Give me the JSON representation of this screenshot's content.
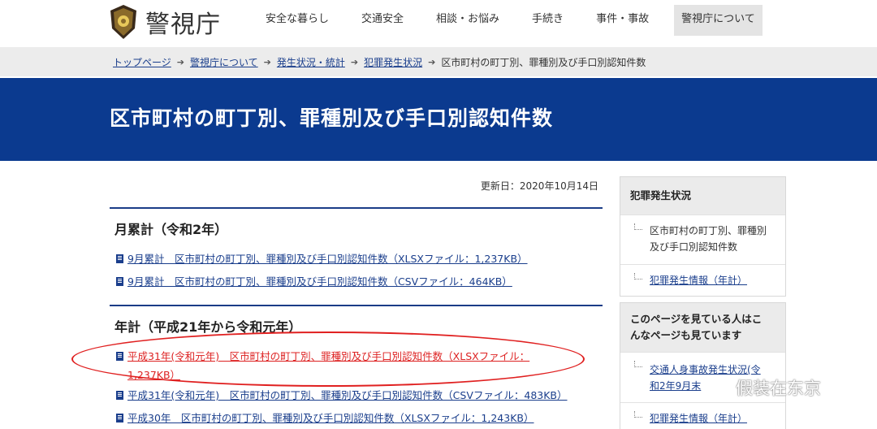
{
  "header": {
    "logo_text": "警視庁",
    "nav": [
      "安全な暮らし",
      "交通安全",
      "相談・お悩み",
      "手続き",
      "事件・事故",
      "警視庁について"
    ]
  },
  "breadcrumb": {
    "links": [
      "トップページ",
      "警視庁について",
      "発生状況・統計",
      "犯罪発生状況"
    ],
    "current": "区市町村の町丁別、罪種別及び手口別認知件数"
  },
  "page_title": "区市町村の町丁別、罪種別及び手口別認知件数",
  "updated": "更新日：2020年10月14日",
  "sections": [
    {
      "heading": "月累計（令和2年）",
      "links": [
        "9月累計　区市町村の町丁別、罪種別及び手口別認知件数（XLSXファイル：1,237KB）",
        "9月累計　区市町村の町丁別、罪種別及び手口別認知件数（CSVファイル：464KB）"
      ]
    },
    {
      "heading": "年計（平成21年から令和元年）",
      "links": [
        "平成31年(令和元年)　区市町村の町丁別、罪種別及び手口別認知件数（XLSXファイル：",
        "平成31年(令和元年)　区市町村の町丁別、罪種別及び手口別認知件数（CSVファイル：483KB）",
        "平成30年　区市町村の町丁別、罪種別及び手口別認知件数（XLSXファイル：1,243KB）"
      ],
      "link0_continuation": "1,237KB）"
    }
  ],
  "sidebar": {
    "box1": {
      "heading": "犯罪発生状況",
      "items": [
        "区市町村の町丁別、罪種別",
        "及び手口別認知件数",
        "犯罪発生情報（年計）"
      ]
    },
    "box2": {
      "heading_line1": "このページを見ている人はこ",
      "heading_line2": "んなページも見ています",
      "items": [
        "交通人身事故発生状況(令",
        "和2年9月末",
        "犯罪発生情報（年計）"
      ]
    }
  },
  "watermark": "假装在东京",
  "colors": {
    "navy": "#0b3a8f",
    "link": "#1a3e8c",
    "highlight": "#d22222"
  }
}
